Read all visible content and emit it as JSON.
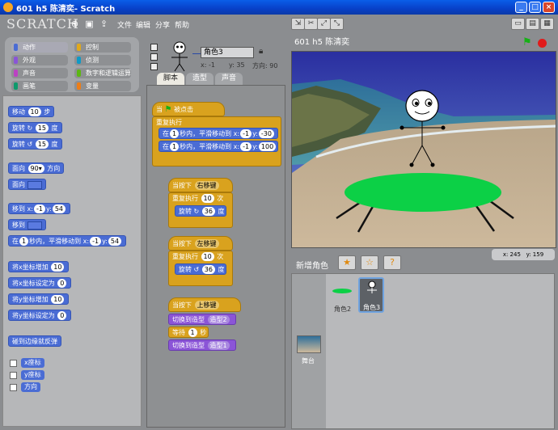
{
  "window": {
    "title": "601 h5 陈清奕- Scratch"
  },
  "menu": {
    "logo": "SCRATCH",
    "items": [
      "文件",
      "编辑",
      "分享",
      "帮助"
    ]
  },
  "categories": [
    {
      "label": "动作",
      "color": "#4a6cd4",
      "active": true
    },
    {
      "label": "控制",
      "color": "#e1a91a",
      "active": false
    },
    {
      "label": "外观",
      "color": "#8a55d7",
      "active": false
    },
    {
      "label": "侦测",
      "color": "#0e9ac6",
      "active": false
    },
    {
      "label": "声音",
      "color": "#bb42c3",
      "active": false
    },
    {
      "label": "数字和逻辑运算",
      "color": "#5cb712",
      "active": false
    },
    {
      "label": "画笔",
      "color": "#0e9a6c",
      "active": false
    },
    {
      "label": "变量",
      "color": "#ee7d16",
      "active": false
    }
  ],
  "palette": {
    "move": {
      "text": "移动",
      "num": "10",
      "tail": "步"
    },
    "turn_right": {
      "text": "旋转 ↻",
      "num": "15",
      "tail": "度"
    },
    "turn_left": {
      "text": "旋转 ↺",
      "num": "15",
      "tail": "度"
    },
    "point_dir": {
      "text": "面向",
      "num": "90▾",
      "tail": "方向"
    },
    "point_towards": {
      "text": "面向"
    },
    "goto_xy": {
      "text": "移到 x:",
      "x": "-1",
      "mid": "y:",
      "y": "54"
    },
    "goto": {
      "text": "移到"
    },
    "glide": {
      "text": "在",
      "secs": "1",
      "mid": "秒内，平滑移动到 x:",
      "x": "-1",
      "mid2": "y:",
      "y": "54"
    },
    "change_x": {
      "text": "将x坐标增加",
      "num": "10"
    },
    "set_x": {
      "text": "将x坐标设定为",
      "num": "0"
    },
    "change_y": {
      "text": "将y坐标增加",
      "num": "10"
    },
    "set_y": {
      "text": "将y坐标设定为",
      "num": "0"
    },
    "bounce": {
      "text": "碰到边缘就反弹"
    },
    "rep_x": "x座标",
    "rep_y": "y座标",
    "rep_dir": "方向"
  },
  "sprite": {
    "name": "角色3",
    "x_label": "x: -1",
    "y_label": "y: 35",
    "dir_label": "方向: 90"
  },
  "tabs": [
    "脚本",
    "造型",
    "声音"
  ],
  "scripts": {
    "s1_hat": "当",
    "s1_hat_tail": "被点击",
    "s1_forever": "重复执行",
    "s1_g1": {
      "a": "在",
      "secs": "1",
      "b": "秒内，平滑移动到 x:",
      "x": "-1",
      "c": "y:",
      "y": "-30"
    },
    "s1_g2": {
      "a": "在",
      "secs": "1",
      "b": "秒内，平滑移动到 x:",
      "x": "-1",
      "c": "y:",
      "y": "100"
    },
    "s2_hat": "当按下",
    "s2_key": "右移键",
    "s2_repeat": "重复执行",
    "s2_num": "10",
    "s2_times": "次",
    "s2_turn": "旋转 ↻",
    "s2_deg": "36",
    "s2_unit": "度",
    "s3_hat": "当按下",
    "s3_key": "左移键",
    "s3_repeat": "重复执行",
    "s3_num": "10",
    "s3_times": "次",
    "s3_turn": "旋转 ↺",
    "s3_deg": "36",
    "s3_unit": "度",
    "s4_hat": "当按下",
    "s4_key": "上移键",
    "s4_sw1": "切换到造型",
    "s4_c1": "造型2",
    "s4_wait": "等待",
    "s4_secs": "1",
    "s4_sec_unit": "秒",
    "s4_sw2": "切换到造型",
    "s4_c2": "造型1"
  },
  "stage": {
    "title": "601 h5 陈清奕",
    "coords_x": "x: 245",
    "coords_y": "y: 159"
  },
  "new_sprite": {
    "label": "新增角色"
  },
  "sprite_list": [
    {
      "name": "角色2"
    },
    {
      "name": "角色3"
    }
  ],
  "stage_thumb": {
    "label": "舞台"
  }
}
